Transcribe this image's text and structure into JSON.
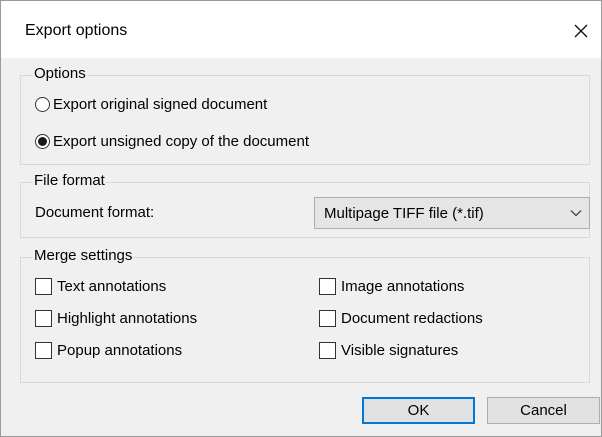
{
  "window": {
    "title": "Export options"
  },
  "options": {
    "legend": "Options",
    "radios": [
      {
        "label": "Export original signed document",
        "checked": false
      },
      {
        "label": "Export unsigned copy of the document",
        "checked": true
      }
    ]
  },
  "file_format": {
    "legend": "File format",
    "label": "Document format:",
    "selected": "Multipage TIFF file (*.tif)"
  },
  "merge": {
    "legend": "Merge settings",
    "checkboxes": [
      {
        "label": "Text annotations",
        "checked": false
      },
      {
        "label": "Highlight annotations",
        "checked": false
      },
      {
        "label": "Popup annotations",
        "checked": false
      },
      {
        "label": "Image annotations",
        "checked": false
      },
      {
        "label": "Document redactions",
        "checked": false
      },
      {
        "label": "Visible signatures",
        "checked": false
      }
    ]
  },
  "buttons": {
    "ok": "OK",
    "cancel": "Cancel"
  },
  "colors": {
    "accent": "#0078d7",
    "background": "#f0f0f0"
  }
}
